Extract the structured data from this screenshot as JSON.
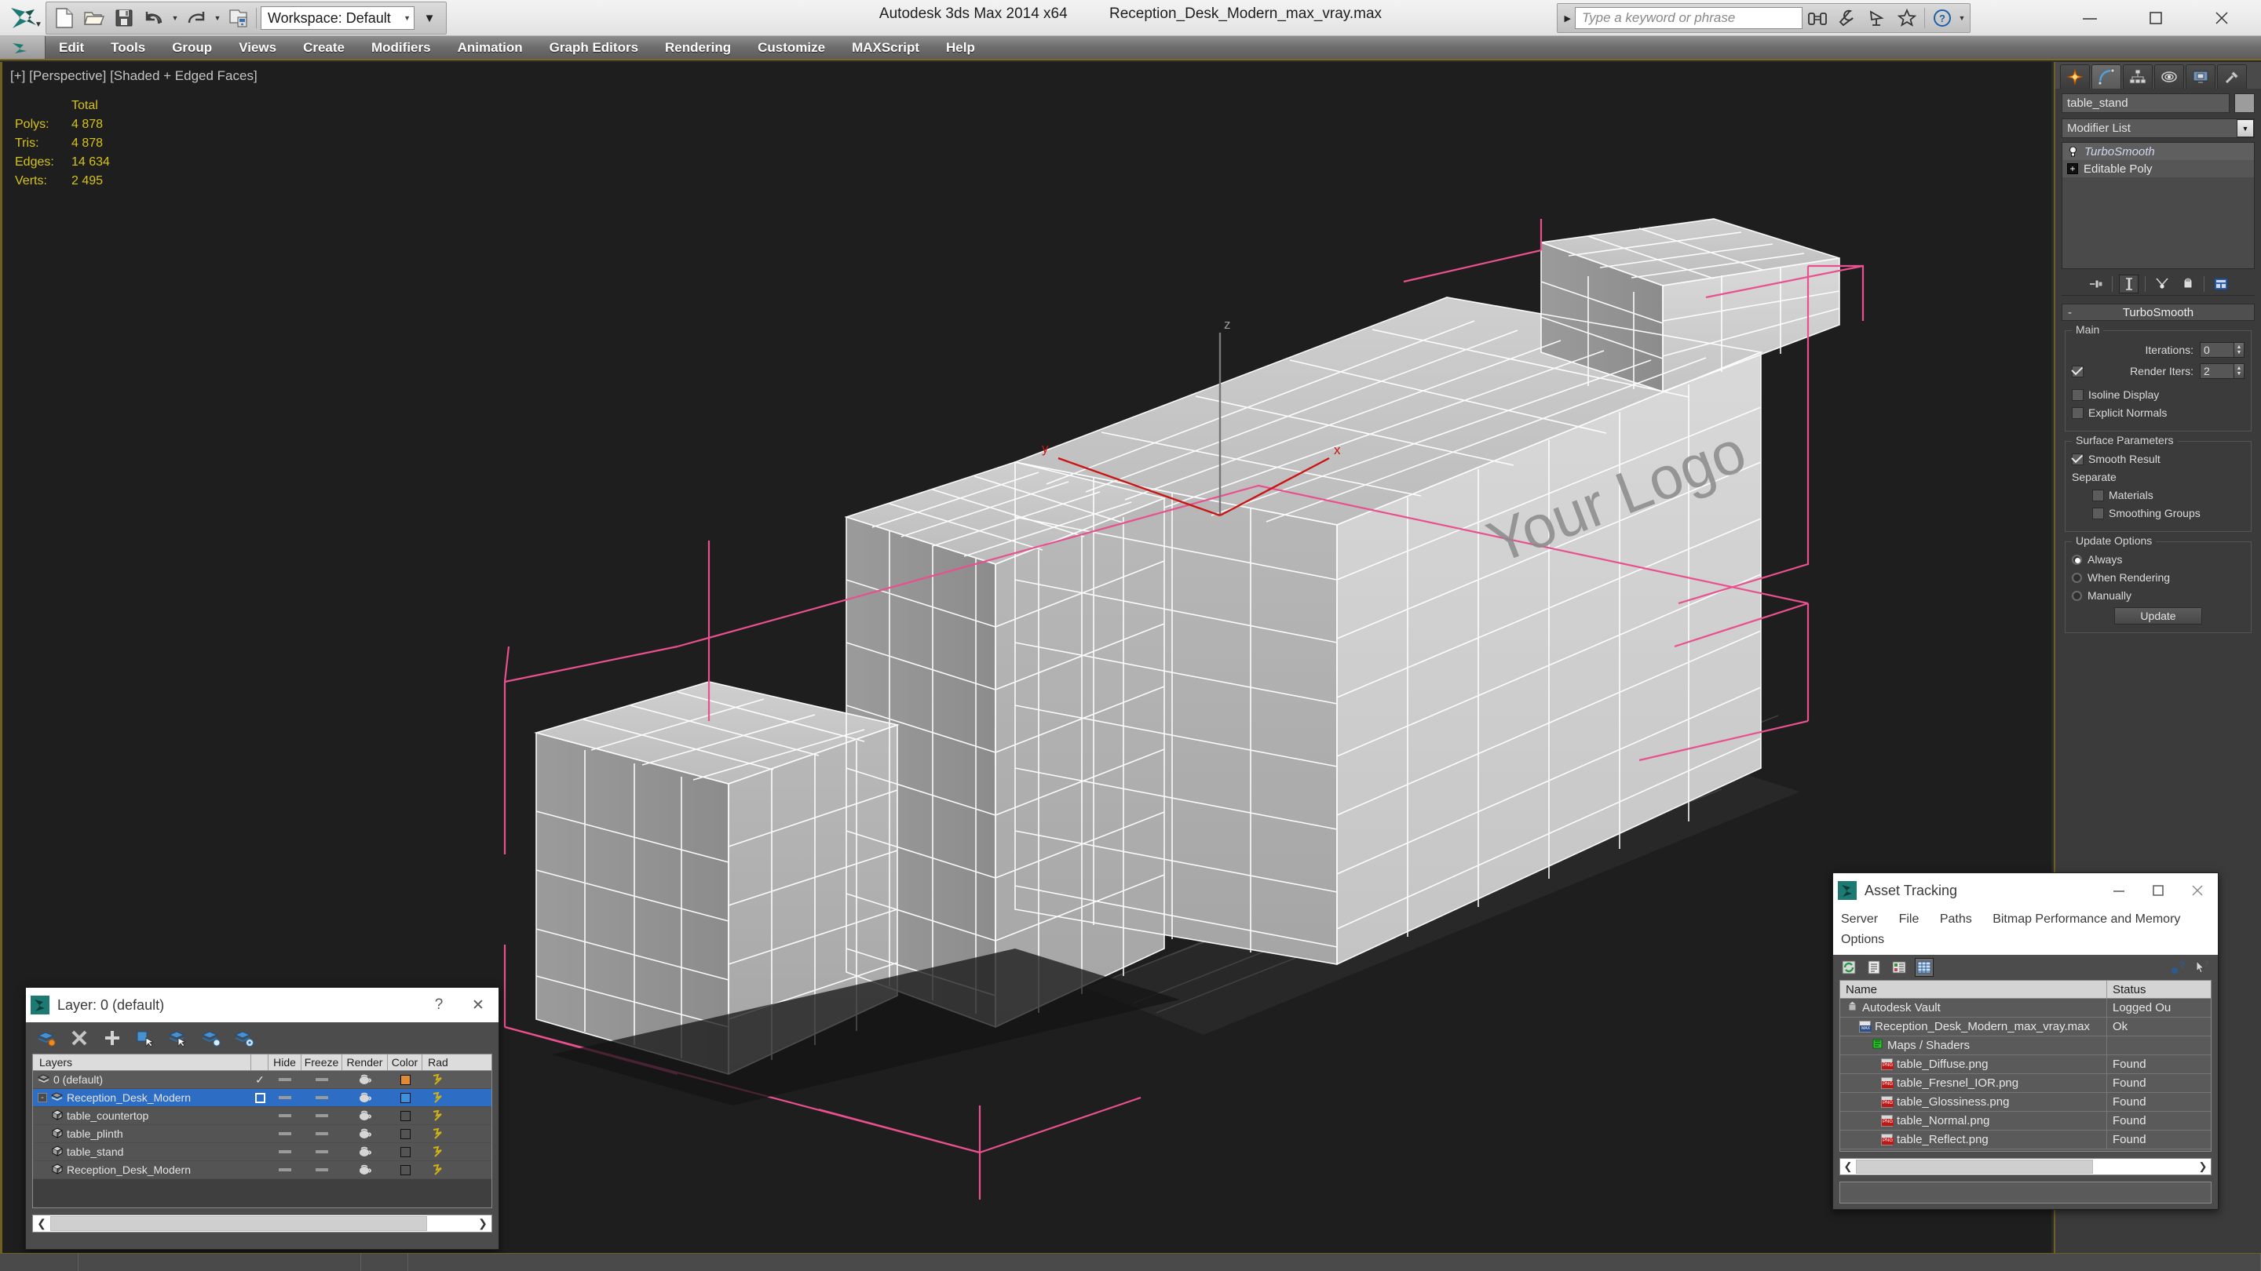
{
  "titlebar": {
    "app_name": "Autodesk 3ds Max 2014 x64",
    "file_name": "Reception_Desk_Modern_max_vray.max",
    "workspace_label": "Workspace: Default",
    "search_placeholder": "Type a keyword or phrase",
    "quick_access": [
      {
        "name": "new-file",
        "glyph": "new"
      },
      {
        "name": "open-file",
        "glyph": "open"
      },
      {
        "name": "save-file",
        "glyph": "save"
      },
      {
        "name": "undo",
        "glyph": "undo"
      },
      {
        "name": "redo",
        "glyph": "redo"
      },
      {
        "name": "project-folder",
        "glyph": "project"
      }
    ],
    "help_icons": [
      "binoculars-icon",
      "wrench-icon",
      "satellite-icon",
      "star-icon",
      "help-icon"
    ],
    "window_controls": [
      "minimize",
      "maximize",
      "close"
    ]
  },
  "menubar": {
    "items": [
      "Edit",
      "Tools",
      "Group",
      "Views",
      "Create",
      "Modifiers",
      "Animation",
      "Graph Editors",
      "Rendering",
      "Customize",
      "MAXScript",
      "Help"
    ]
  },
  "viewport": {
    "label": "[+] [Perspective] [Shaded + Edged Faces]",
    "stats": {
      "header": "Total",
      "rows": [
        {
          "label": "Polys:",
          "value": "4 878"
        },
        {
          "label": "Tris:",
          "value": "4 878"
        },
        {
          "label": "Edges:",
          "value": "14 634"
        },
        {
          "label": "Verts:",
          "value": "2 495"
        }
      ]
    },
    "gizmo": {
      "x": "x",
      "y": "y",
      "z": "z"
    },
    "model_logo_text": "Your Logo",
    "colors": {
      "background": "#1e1e1e",
      "selection_bracket": "#e8508f",
      "gizmo_xy": "#cc1414",
      "wireframe": "#ffffff"
    }
  },
  "command_panel": {
    "tabs": [
      "create-tab",
      "modify-tab",
      "hierarchy-tab",
      "motion-tab",
      "display-tab",
      "utilities-tab"
    ],
    "active_tab_index": 1,
    "object_name": "table_stand",
    "modifier_list_label": "Modifier List",
    "modifier_stack": [
      {
        "name": "TurboSmooth",
        "type": "modifier"
      },
      {
        "name": "Editable Poly",
        "type": "base"
      }
    ],
    "stack_tools": [
      "pin-stack-icon",
      "show-end-result-icon",
      "make-unique-icon",
      "remove-modifier-icon",
      "configure-modifier-sets-icon"
    ],
    "rollout": {
      "title": "TurboSmooth",
      "collapse_glyph": "-",
      "main_group": "Main",
      "iterations_label": "Iterations:",
      "iterations_value": "0",
      "render_iters_label": "Render Iters:",
      "render_iters_value": "2",
      "render_iters_checked": true,
      "isoline_display_label": "Isoline Display",
      "isoline_display_checked": false,
      "explicit_normals_label": "Explicit Normals",
      "explicit_normals_checked": false,
      "surface_group": "Surface Parameters",
      "smooth_result_label": "Smooth Result",
      "smooth_result_checked": true,
      "separate_label": "Separate",
      "materials_label": "Materials",
      "materials_checked": false,
      "smoothing_groups_label": "Smoothing Groups",
      "smoothing_groups_checked": false,
      "update_group": "Update Options",
      "update_option_always": "Always",
      "update_option_when_rendering": "When Rendering",
      "update_option_manually": "Manually",
      "update_selected": "Always",
      "update_button": "Update"
    }
  },
  "layer_dialog": {
    "title": "Layer: 0 (default)",
    "help_glyph": "?",
    "close_glyph": "✕",
    "toolbar": [
      "create-new-layer-icon",
      "delete-layer-icon",
      "add-selection-icon",
      "select-objects-icon",
      "select-highlighted-icon",
      "highlight-selected-icon",
      "layer-properties-icon"
    ],
    "columns": [
      "Layers",
      "",
      "Hide",
      "Freeze",
      "Render",
      "Color",
      "Rad"
    ],
    "rows": [
      {
        "name": "0 (default)",
        "indent": 0,
        "selected": false,
        "expander": "",
        "check": "✓",
        "color": "#e08a36",
        "icon": "layer-icon"
      },
      {
        "name": "Reception_Desk_Modern",
        "indent": 0,
        "selected": true,
        "expander": "-",
        "check": "box",
        "color": "#3f8fdf",
        "icon": "layer-icon"
      },
      {
        "name": "table_countertop",
        "indent": 1,
        "selected": false,
        "expander": "",
        "check": "",
        "color": "none",
        "icon": "object-icon"
      },
      {
        "name": "table_plinth",
        "indent": 1,
        "selected": false,
        "expander": "",
        "check": "",
        "color": "none",
        "icon": "object-icon"
      },
      {
        "name": "table_stand",
        "indent": 1,
        "selected": false,
        "expander": "",
        "check": "",
        "color": "none",
        "icon": "object-icon"
      },
      {
        "name": "Reception_Desk_Modern",
        "indent": 1,
        "selected": false,
        "expander": "",
        "check": "",
        "color": "none",
        "icon": "object-icon"
      }
    ]
  },
  "asset_tracking": {
    "title": "Asset Tracking",
    "menu": [
      "Server",
      "File",
      "Paths",
      "Bitmap Performance and Memory",
      "Options"
    ],
    "toolbar": [
      "refresh-icon",
      "list-view-icon",
      "detail-view-icon",
      "grid-view-icon"
    ],
    "help_icons": [
      "whats-this-icon",
      "help-pointer-icon"
    ],
    "columns": [
      "Name",
      "Status"
    ],
    "rows": [
      {
        "name": "Autodesk Vault",
        "status": "Logged Ou",
        "indent": 0,
        "icon": "vault-icon"
      },
      {
        "name": "Reception_Desk_Modern_max_vray.max",
        "status": "Ok",
        "indent": 1,
        "icon": "max-file-icon"
      },
      {
        "name": "Maps / Shaders",
        "status": "",
        "indent": 2,
        "icon": "maps-shaders-icon"
      },
      {
        "name": "table_Diffuse.png",
        "status": "Found",
        "indent": 3,
        "icon": "png-file-icon"
      },
      {
        "name": "table_Fresnel_IOR.png",
        "status": "Found",
        "indent": 3,
        "icon": "png-file-icon"
      },
      {
        "name": "table_Glossiness.png",
        "status": "Found",
        "indent": 3,
        "icon": "png-file-icon"
      },
      {
        "name": "table_Normal.png",
        "status": "Found",
        "indent": 3,
        "icon": "png-file-icon"
      },
      {
        "name": "table_Reflect.png",
        "status": "Found",
        "indent": 3,
        "icon": "png-file-icon"
      }
    ],
    "window_controls": [
      "minimize",
      "maximize",
      "close"
    ]
  }
}
